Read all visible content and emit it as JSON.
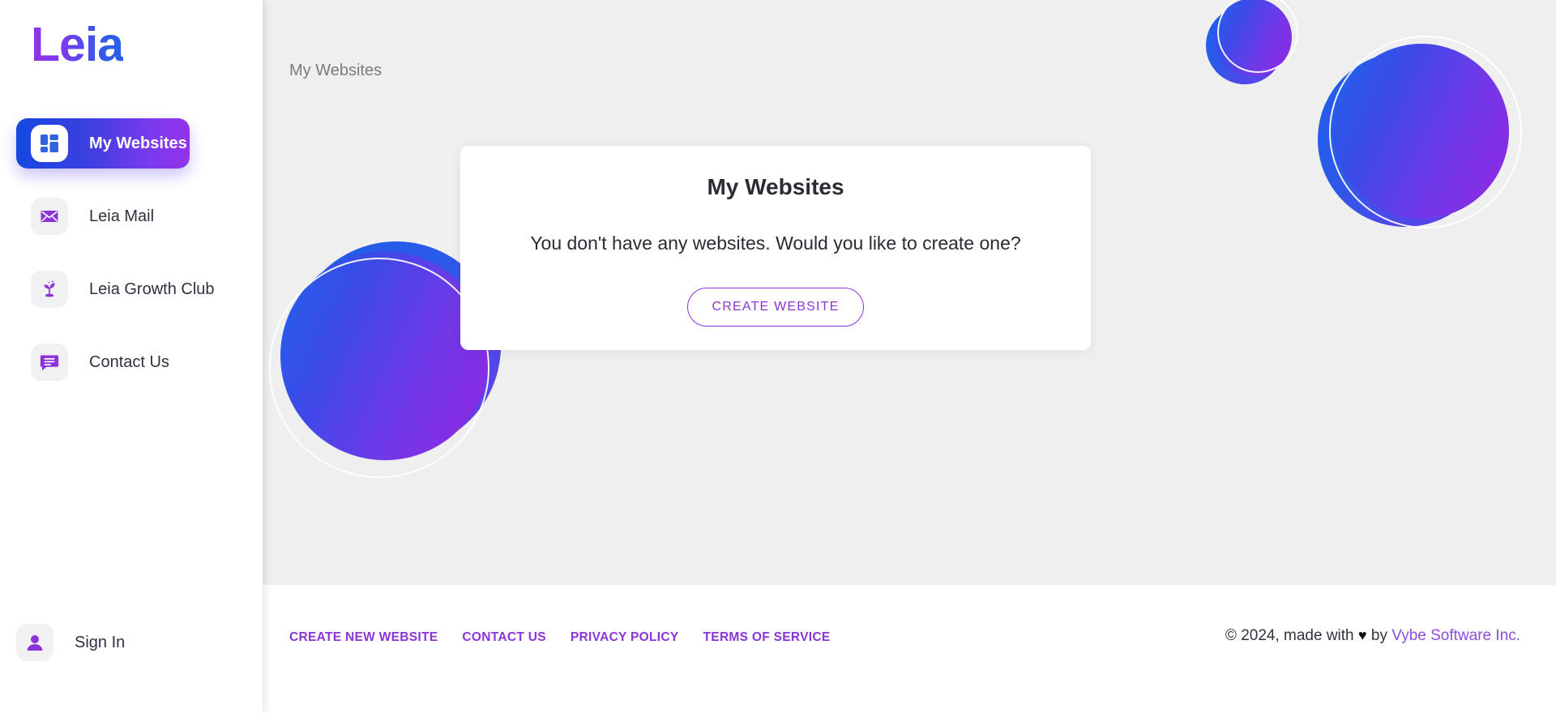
{
  "brand": {
    "name": "Leia"
  },
  "sidebar": {
    "items": [
      {
        "label": "My Websites",
        "icon": "dashboard-grid-icon",
        "active": true
      },
      {
        "label": "Leia Mail",
        "icon": "envelope-icon",
        "active": false
      },
      {
        "label": "Leia Growth Club",
        "icon": "plant-sprout-icon",
        "active": false
      },
      {
        "label": "Contact Us",
        "icon": "chat-bubble-icon",
        "active": false
      }
    ],
    "signin": {
      "label": "Sign In",
      "icon": "user-avatar-icon"
    }
  },
  "breadcrumb": {
    "label": "My Websites"
  },
  "card": {
    "title": "My Websites",
    "message": "You don't have any websites. Would you like to create one?",
    "button_label": "CREATE WEBSITE"
  },
  "footer": {
    "links": [
      {
        "label": "CREATE NEW WEBSITE"
      },
      {
        "label": "CONTACT US"
      },
      {
        "label": "PRIVACY POLICY"
      },
      {
        "label": "TERMS OF SERVICE"
      }
    ],
    "copyright_prefix": "© 2024, made with",
    "heart": "♥",
    "copyright_by": "by",
    "company": "Vybe Software Inc."
  },
  "colors": {
    "accent_purple": "#8b34d8",
    "accent_blue": "#1547e0",
    "content_bg": "#efefef"
  }
}
